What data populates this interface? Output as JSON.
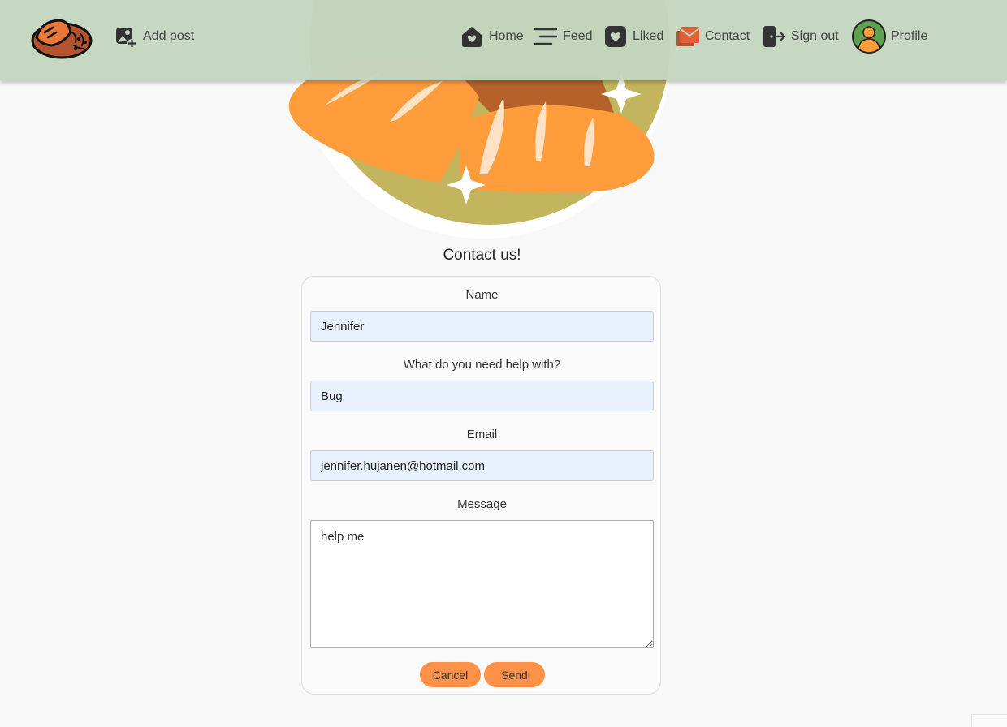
{
  "nav": {
    "add_post": "Add post",
    "home": "Home",
    "feed": "Feed",
    "liked": "Liked",
    "contact": "Contact",
    "sign_out": "Sign out",
    "profile": "Profile"
  },
  "form": {
    "title": "Contact us!",
    "name_label": "Name",
    "name_value": "Jennifer",
    "topic_label": "What do you need help with?",
    "topic_value": "Bug",
    "email_label": "Email",
    "email_value": "jennifer.hujanen@hotmail.com",
    "message_label": "Message",
    "message_value": "help me",
    "cancel_label": "Cancel",
    "send_label": "Send"
  },
  "colors": {
    "header_bg": "#c4d5bf",
    "accent": "#ff9149",
    "input_bg": "#e8f0fe"
  },
  "icons": [
    "bread-logo-icon",
    "add-image-icon",
    "home-icon",
    "feed-icon",
    "liked-heart-icon",
    "contact-mail-icon",
    "sign-out-icon",
    "profile-avatar-icon"
  ]
}
